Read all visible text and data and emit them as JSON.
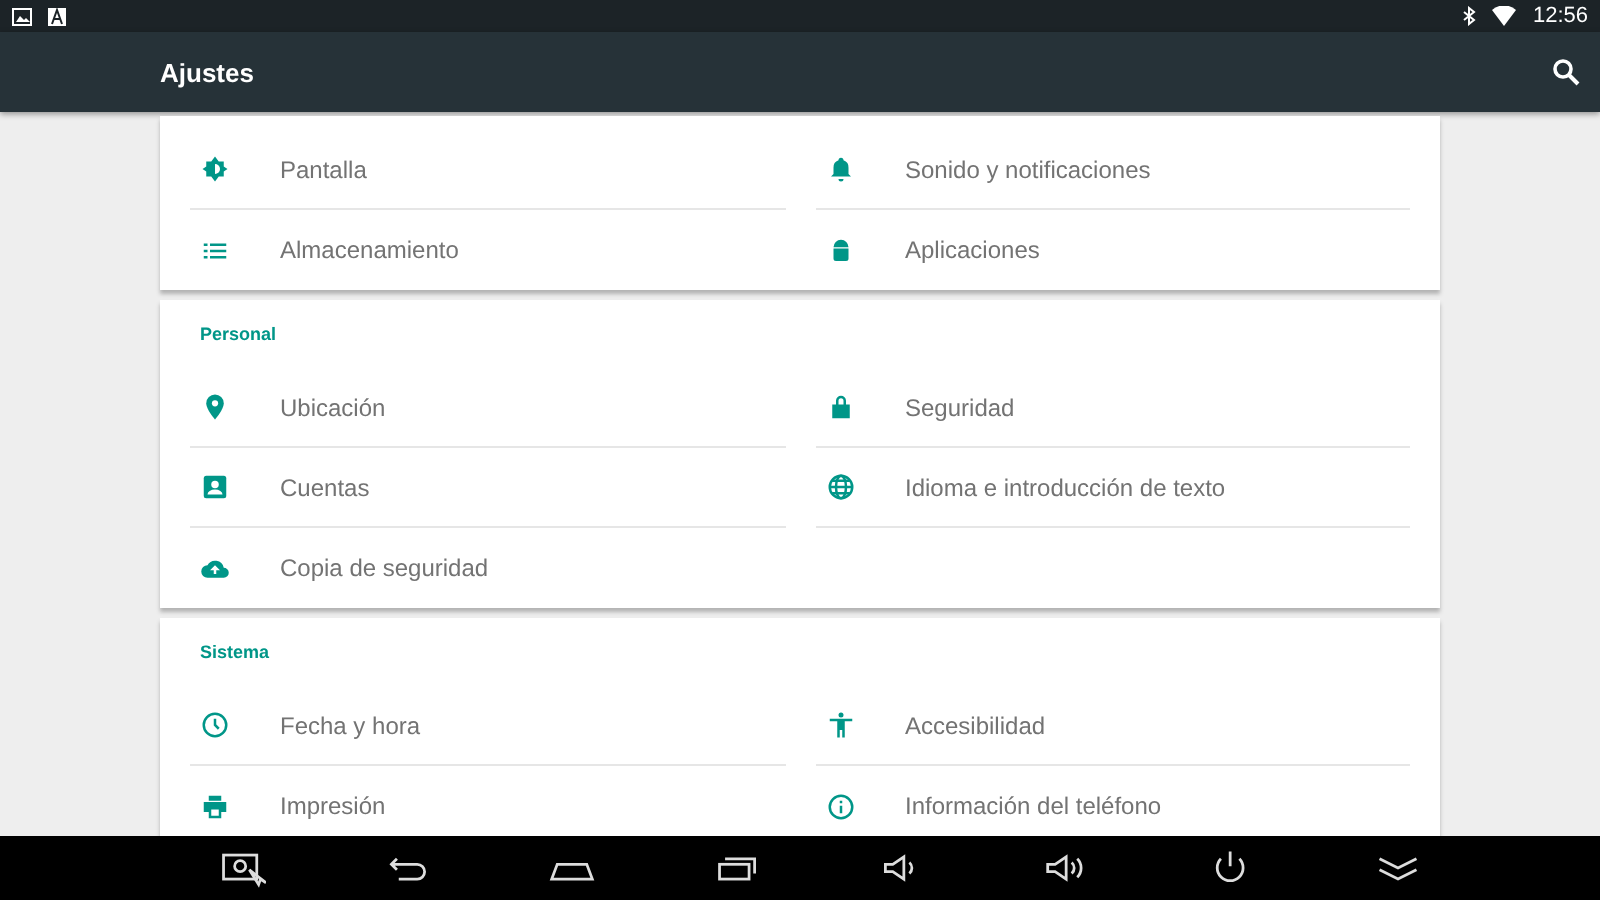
{
  "status_bar": {
    "time": "12:56"
  },
  "app_bar": {
    "title": "Ajustes"
  },
  "sections": [
    {
      "items": [
        {
          "label": "Pantalla"
        },
        {
          "label": "Sonido y notificaciones"
        },
        {
          "label": "Almacenamiento"
        },
        {
          "label": "Aplicaciones"
        }
      ]
    },
    {
      "header": "Personal",
      "items": [
        {
          "label": "Ubicación"
        },
        {
          "label": "Seguridad"
        },
        {
          "label": "Cuentas"
        },
        {
          "label": "Idioma e introducción de texto"
        },
        {
          "label": "Copia de seguridad"
        }
      ]
    },
    {
      "header": "Sistema",
      "items": [
        {
          "label": "Fecha y hora"
        },
        {
          "label": "Accesibilidad"
        },
        {
          "label": "Impresión"
        },
        {
          "label": "Información del teléfono"
        }
      ]
    }
  ]
}
